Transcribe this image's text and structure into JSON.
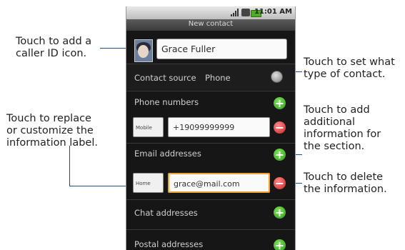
{
  "callouts": {
    "caller_id": "Touch to add a\ncaller ID icon.",
    "contact_type": "Touch to set what\ntype of contact.",
    "replace_label": "Touch to replace\nor customize the\ninformation label.",
    "add_info": "Touch to add\nadditional\ninformation for\nthe section.",
    "delete_info": "Touch to delete\nthe information."
  },
  "status_bar": {
    "time": "11:01 AM"
  },
  "screen": {
    "title": "New contact",
    "name": "Grace Fuller",
    "contact_source_label": "Contact source",
    "contact_source_value": "Phone",
    "phone_section": "Phone numbers",
    "phone_type": "Mobile",
    "phone_value": "+19099999999",
    "email_section": "Email addresses",
    "email_type": "Home",
    "email_value": "grace@mail.com",
    "chat_section": "Chat addresses",
    "postal_section": "Postal addresses"
  },
  "icons": {
    "add": "plus-icon",
    "remove": "minus-icon",
    "settings": "gear-icon"
  }
}
